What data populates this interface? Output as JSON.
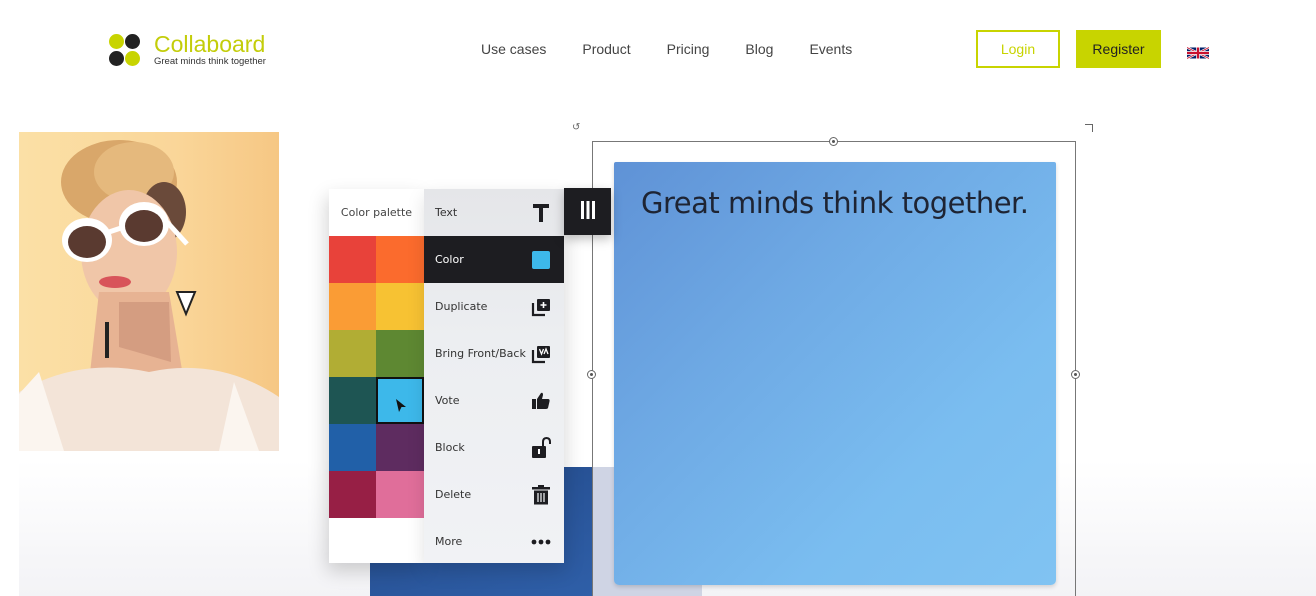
{
  "header": {
    "logo": {
      "name": "Collaboard",
      "tagline": "Great minds think together"
    },
    "nav": [
      {
        "label": "Use cases"
      },
      {
        "label": "Product"
      },
      {
        "label": "Pricing"
      },
      {
        "label": "Blog"
      },
      {
        "label": "Events"
      }
    ],
    "login_label": "Login",
    "register_label": "Register",
    "language_icon": "uk-flag-icon"
  },
  "colors": {
    "brand_accent": "#c8d400",
    "menu_dark": "#1d1d21",
    "sticky_blue": "#6ea9e4"
  },
  "hero": {
    "photo_alt": "woman-with-sunglasses-photo",
    "sticky_note_text": "Great minds think together.",
    "palette": {
      "title": "Color palette",
      "swatches": [
        {
          "color": "#e8423a"
        },
        {
          "color": "#fb6b2d"
        },
        {
          "color": "#fa9c35"
        },
        {
          "color": "#f7c233"
        },
        {
          "color": "#b1ad34"
        },
        {
          "color": "#5e8832"
        },
        {
          "color": "#1e5553"
        },
        {
          "color": "#3db8ea",
          "selected": true
        },
        {
          "color": "#2160a8"
        },
        {
          "color": "#5e2c60"
        },
        {
          "color": "#971f45"
        },
        {
          "color": "#e06e9a"
        }
      ]
    },
    "context_menu": [
      {
        "label": "Text",
        "icon": "text-icon"
      },
      {
        "label": "Color",
        "icon": "color-swatch-icon",
        "active": true
      },
      {
        "label": "Duplicate",
        "icon": "duplicate-icon"
      },
      {
        "label": "Bring Front/Back",
        "icon": "bring-front-back-icon"
      },
      {
        "label": "Vote",
        "icon": "thumbs-up-icon"
      },
      {
        "label": "Block",
        "icon": "unlock-icon"
      },
      {
        "label": "Delete",
        "icon": "trash-icon"
      },
      {
        "label": "More",
        "icon": "more-icon"
      }
    ]
  }
}
